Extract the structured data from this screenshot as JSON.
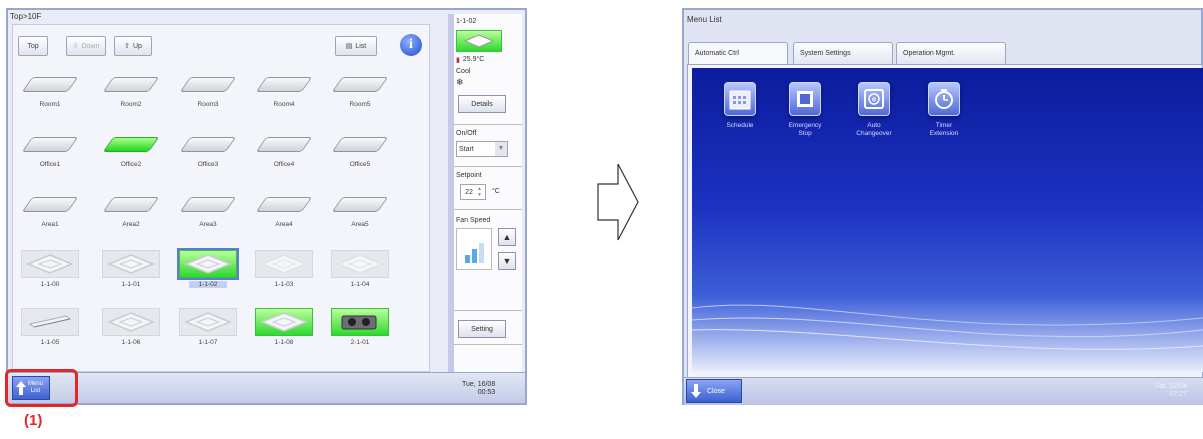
{
  "left": {
    "breadcrumb": "Top>10F",
    "toolbar": {
      "top": "Top",
      "down": "Down",
      "up": "Up",
      "list": "List"
    },
    "grid": [
      {
        "label": "Room1",
        "type": "slab"
      },
      {
        "label": "Room2",
        "type": "slab"
      },
      {
        "label": "Room3",
        "type": "slab"
      },
      {
        "label": "Room4",
        "type": "slab"
      },
      {
        "label": "Room5",
        "type": "slab"
      },
      {
        "label": "Office1",
        "type": "slab"
      },
      {
        "label": "Office2",
        "type": "slab",
        "on": true
      },
      {
        "label": "Office3",
        "type": "slab"
      },
      {
        "label": "Office4",
        "type": "slab"
      },
      {
        "label": "Office5",
        "type": "slab"
      },
      {
        "label": "Area1",
        "type": "slab"
      },
      {
        "label": "Area2",
        "type": "slab"
      },
      {
        "label": "Area3",
        "type": "slab"
      },
      {
        "label": "Area4",
        "type": "slab"
      },
      {
        "label": "Area5",
        "type": "slab"
      },
      {
        "label": "1-1-00",
        "type": "cassette"
      },
      {
        "label": "1-1-01",
        "type": "cassette"
      },
      {
        "label": "1-1-02",
        "type": "cassette",
        "on": true,
        "selected": true
      },
      {
        "label": "1-1-03",
        "type": "cassette-light"
      },
      {
        "label": "1-1-04",
        "type": "cassette-light"
      },
      {
        "label": "1-1-05",
        "type": "wall"
      },
      {
        "label": "1-1-06",
        "type": "cassette"
      },
      {
        "label": "1-1-07",
        "type": "cassette"
      },
      {
        "label": "1-1-08",
        "type": "cassette",
        "on": true
      },
      {
        "label": "2-1-01",
        "type": "unit",
        "on": true
      }
    ],
    "info": {
      "unit": "1-1-02",
      "temp": "25.9°C",
      "mode": "Cool",
      "details": "Details",
      "onoff_label": "On/Off",
      "onoff_value": "Start",
      "setpoint_label": "Setpoint",
      "setpoint_value": "22",
      "setpoint_unit": "°C",
      "fan_label": "Fan Speed",
      "setting": "Setting"
    },
    "menu_button": "Menu\nList",
    "date": "Tue, 16/08",
    "time": "00:53",
    "callout": "(1)"
  },
  "right": {
    "title": "Menu List",
    "tabs": [
      "Automatic Ctrl",
      "System Settings",
      "Operation Mgmt."
    ],
    "items": [
      {
        "label": "Schedule",
        "icon": "calendar-icon"
      },
      {
        "label": "Emergency\nStop",
        "icon": "emergency-stop-icon"
      },
      {
        "label": "Auto\nChangeover",
        "icon": "auto-changeover-icon"
      },
      {
        "label": "Timer\nExtension",
        "icon": "timer-icon"
      }
    ],
    "close": "Close",
    "date": "Sat, 02/04",
    "time": "07:27"
  },
  "colors": {
    "accent": "#e0272a",
    "on_green": "#2fd82f",
    "menu_blue": "#1b31c0"
  }
}
